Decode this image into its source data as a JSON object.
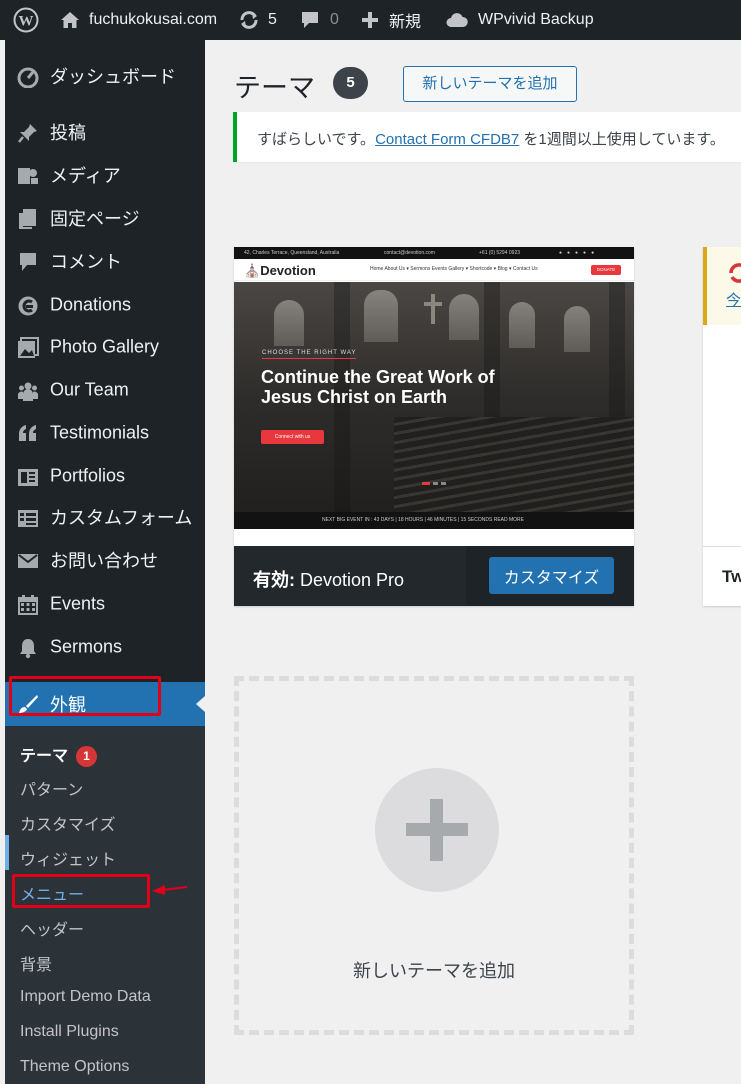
{
  "adminbar": {
    "site_name": "fuchukokusai.com",
    "updates_count": "5",
    "comments_count": "0",
    "new_label": "新規",
    "backup_label": "WPvivid Backup"
  },
  "sidebar": {
    "items": [
      {
        "label": "ダッシュボード",
        "icon": "dashboard-icon"
      },
      {
        "label": "投稿",
        "icon": "pin-icon"
      },
      {
        "label": "メディア",
        "icon": "media-icon"
      },
      {
        "label": "固定ページ",
        "icon": "pages-icon"
      },
      {
        "label": "コメント",
        "icon": "comment-icon"
      },
      {
        "label": "Donations",
        "icon": "donations-icon"
      },
      {
        "label": "Photo Gallery",
        "icon": "gallery-icon"
      },
      {
        "label": "Our Team",
        "icon": "team-icon"
      },
      {
        "label": "Testimonials",
        "icon": "quote-icon"
      },
      {
        "label": "Portfolios",
        "icon": "portfolio-icon"
      },
      {
        "label": "カスタムフォーム",
        "icon": "form-icon"
      },
      {
        "label": "お問い合わせ",
        "icon": "mail-icon"
      },
      {
        "label": "Events",
        "icon": "calendar-icon"
      },
      {
        "label": "Sermons",
        "icon": "bell-icon"
      },
      {
        "label": "外観",
        "icon": "brush-icon"
      }
    ],
    "submenu": [
      {
        "label": "テーマ",
        "badge": "1"
      },
      {
        "label": "パターン"
      },
      {
        "label": "カスタマイズ"
      },
      {
        "label": "ウィジェット"
      },
      {
        "label": "メニュー"
      },
      {
        "label": "ヘッダー"
      },
      {
        "label": "背景"
      },
      {
        "label": "Import Demo Data"
      },
      {
        "label": "Install Plugins"
      },
      {
        "label": "Theme Options"
      }
    ]
  },
  "main": {
    "title": "テーマ",
    "count": "5",
    "add_new_button": "新しいテーマを追加",
    "notice": {
      "prefix": "すばらしいです。",
      "link": "Contact Form CFDB7",
      "suffix": " を1週間以上使用しています。"
    },
    "active_theme": {
      "active_label": "有効:",
      "name": " Devotion Pro",
      "customize_button": "カスタマイズ",
      "screenshot": {
        "topbar_address": "42, Charles Terrace, Queensland, Australia",
        "topbar_email": "contact@devotion.com",
        "topbar_phone": "+61 (0) 5294 0923",
        "logo": "Devotion",
        "menu": "Home   About Us ▾   Sermons   Events   Gallery ▾   Shortcode ▾   Blog ▾   Contact Us",
        "donate": "DONATE",
        "kicker": "CHOOSE THE RIGHT WAY",
        "headline": "Continue the Great Work of Jesus Christ on Earth",
        "cta": "Connect with us",
        "next_event": "NEXT BIG EVENT IN :   43 DAYS  |  18 HOURS  |  46 MINUTES  |  15 SECONDS   READ MORE"
      }
    },
    "second_theme": {
      "name_partial": "Tw",
      "link_partial": "今"
    },
    "add_new_theme_label": "新しいテーマを追加"
  },
  "colors": {
    "adminbar_bg": "#1d2327",
    "accent": "#2271b1",
    "notice_border": "#00a32a",
    "badge": "#d63638",
    "annotation": "#e1001a"
  }
}
